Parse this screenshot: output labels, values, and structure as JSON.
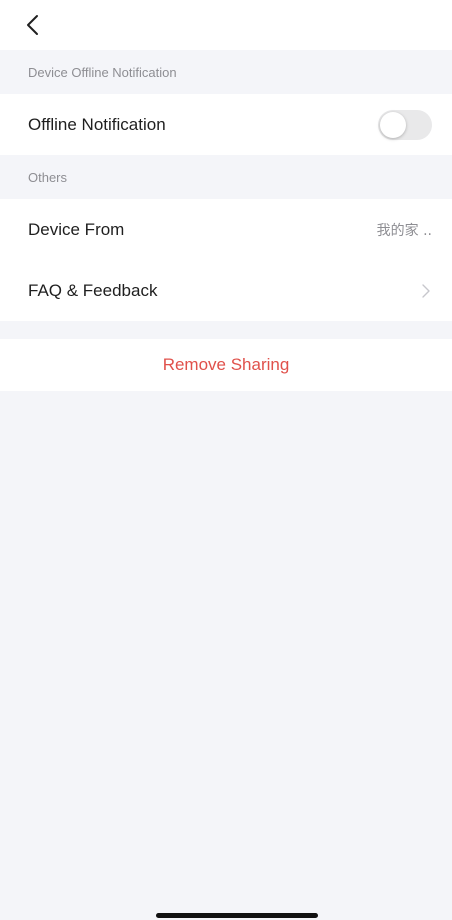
{
  "nav": {
    "back_icon": "chevron-left-icon"
  },
  "sections": {
    "offline": {
      "header": "Device Offline Notification",
      "notification_label": "Offline Notification",
      "notification_enabled": false
    },
    "others": {
      "header": "Others",
      "device_from_label": "Device From",
      "device_from_value": "我的家 ..",
      "faq_label": "FAQ & Feedback",
      "faq_icon": "chevron-right-icon"
    }
  },
  "actions": {
    "remove_sharing_label": "Remove Sharing"
  },
  "colors": {
    "background": "#f4f5f9",
    "destructive": "#e0514b",
    "secondary_text": "#8e8e93"
  }
}
